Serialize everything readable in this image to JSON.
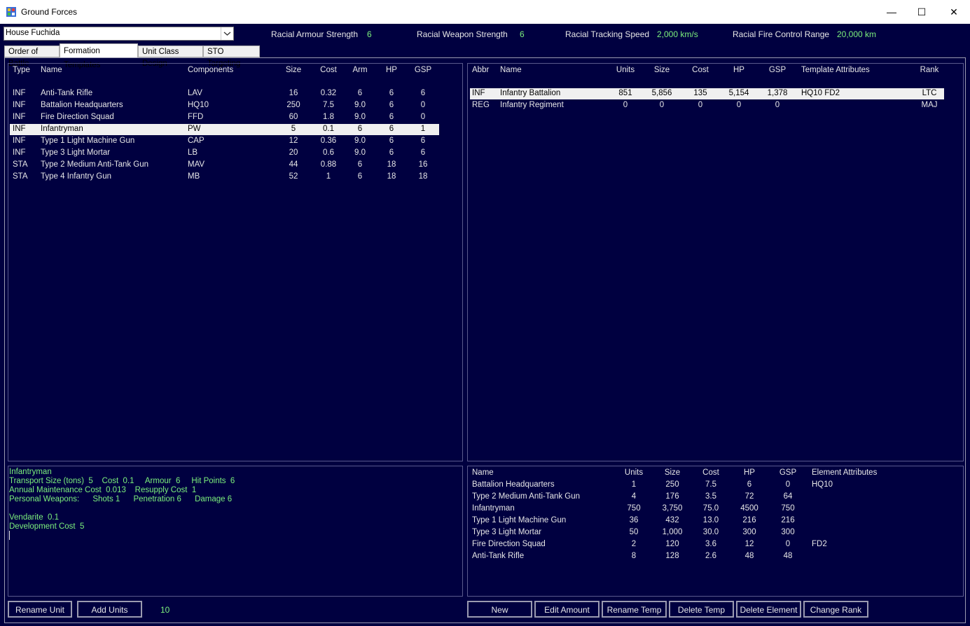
{
  "window": {
    "title": "Ground Forces",
    "minimize": "—",
    "maximize": "☐",
    "close": "✕"
  },
  "race_select": {
    "value": "House Fuchida"
  },
  "racial": [
    {
      "label": "Racial Armour Strength",
      "value": "6"
    },
    {
      "label": "Racial Weapon Strength",
      "value": "6"
    },
    {
      "label": "Racial Tracking Speed",
      "value": "2,000 km/s"
    },
    {
      "label": "Racial Fire Control Range",
      "value": "20,000 km"
    }
  ],
  "tabs": [
    "Order of Battle",
    "Formation Templates",
    "Unit Class Design",
    "STO Targeting"
  ],
  "active_tab": "Formation Templates",
  "units": {
    "headers": [
      "Type",
      "Name",
      "Components",
      "Size",
      "Cost",
      "Arm",
      "HP",
      "GSP"
    ],
    "rows": [
      [
        "INF",
        "Anti-Tank Rifle",
        "LAV",
        "16",
        "0.32",
        "6",
        "6",
        "6"
      ],
      [
        "INF",
        "Battalion Headquarters",
        "HQ10",
        "250",
        "7.5",
        "9.0",
        "6",
        "0"
      ],
      [
        "INF",
        "Fire Direction Squad",
        "FFD",
        "60",
        "1.8",
        "9.0",
        "6",
        "0"
      ],
      [
        "INF",
        "Infantryman",
        "PW",
        "5",
        "0.1",
        "6",
        "6",
        "1"
      ],
      [
        "INF",
        "Type 1 Light Machine Gun",
        "CAP",
        "12",
        "0.36",
        "9.0",
        "6",
        "6"
      ],
      [
        "INF",
        "Type 3 Light Mortar",
        "LB",
        "20",
        "0.6",
        "9.0",
        "6",
        "6"
      ],
      [
        "STA",
        "Type 2 Medium Anti-Tank Gun",
        "MAV",
        "44",
        "0.88",
        "6",
        "18",
        "16"
      ],
      [
        "STA",
        "Type 4 Infantry Gun",
        "MB",
        "52",
        "1",
        "6",
        "18",
        "18"
      ]
    ],
    "selected_index": 3
  },
  "templates": {
    "headers": [
      "Abbr",
      "Name",
      "Units",
      "Size",
      "Cost",
      "HP",
      "GSP",
      "Template Attributes",
      "Rank"
    ],
    "rows": [
      [
        "INF",
        "Infantry Battalion",
        "851",
        "5,856",
        "135",
        "5,154",
        "1,378",
        "HQ10  FD2",
        "LTC"
      ],
      [
        "REG",
        "Infantry Regiment",
        "0",
        "0",
        "0",
        "0",
        "0",
        "",
        "MAJ"
      ]
    ],
    "selected_index": 0
  },
  "unit_info": {
    "lines": [
      "Infantryman",
      "Transport Size (tons)  5    Cost  0.1     Armour  6     Hit Points  6",
      "Annual Maintenance Cost  0.013    Resupply Cost  1",
      "Personal Weapons:      Shots 1      Penetration 6      Damage 6",
      "",
      "Vendarite  0.1",
      "Development Cost  5"
    ]
  },
  "elements": {
    "headers": [
      "Name",
      "Units",
      "Size",
      "Cost",
      "HP",
      "GSP",
      "Element Attributes"
    ],
    "rows": [
      [
        "Battalion Headquarters",
        "1",
        "250",
        "7.5",
        "6",
        "0",
        "HQ10"
      ],
      [
        "Type 2 Medium Anti-Tank Gun",
        "4",
        "176",
        "3.5",
        "72",
        "64",
        ""
      ],
      [
        "Infantryman",
        "750",
        "3,750",
        "75.0",
        "4500",
        "750",
        ""
      ],
      [
        "Type 1 Light Machine Gun",
        "36",
        "432",
        "13.0",
        "216",
        "216",
        ""
      ],
      [
        "Type 3 Light Mortar",
        "50",
        "1,000",
        "30.0",
        "300",
        "300",
        ""
      ],
      [
        "Fire Direction Squad",
        "2",
        "120",
        "3.6",
        "12",
        "0",
        "FD2"
      ],
      [
        "Anti-Tank Rifle",
        "8",
        "128",
        "2.6",
        "48",
        "48",
        ""
      ]
    ]
  },
  "buttons": {
    "rename_unit": "Rename Unit",
    "add_units": "Add Units",
    "units_count": "10",
    "new": "New",
    "edit_amount": "Edit Amount",
    "rename_temp": "Rename Temp",
    "delete_temp": "Delete Temp",
    "delete_element": "Delete Element",
    "change_rank": "Change Rank"
  }
}
